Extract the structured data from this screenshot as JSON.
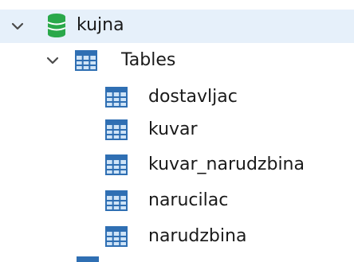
{
  "tree": {
    "database": {
      "name": "kujna",
      "expanded": true,
      "selected": true,
      "icon": "database-icon",
      "icon_color": "#2aa84a"
    },
    "tables_folder": {
      "label": "Tables",
      "expanded": true,
      "icon": "table-grid-icon"
    },
    "tables": [
      {
        "label": "dostavljac",
        "icon": "table-grid-icon"
      },
      {
        "label": "kuvar",
        "icon": "table-grid-icon"
      },
      {
        "label": "kuvar_narudzbina",
        "icon": "table-grid-icon"
      },
      {
        "label": "narucilac",
        "icon": "table-grid-icon"
      },
      {
        "label": "narudzbina",
        "icon": "table-grid-icon"
      }
    ]
  },
  "colors": {
    "selection_bg": "#e6f0fa",
    "table_icon_blue": "#2f6fb3",
    "table_icon_fill": "#cfe4f7",
    "chevron": "#4a4a4a"
  }
}
